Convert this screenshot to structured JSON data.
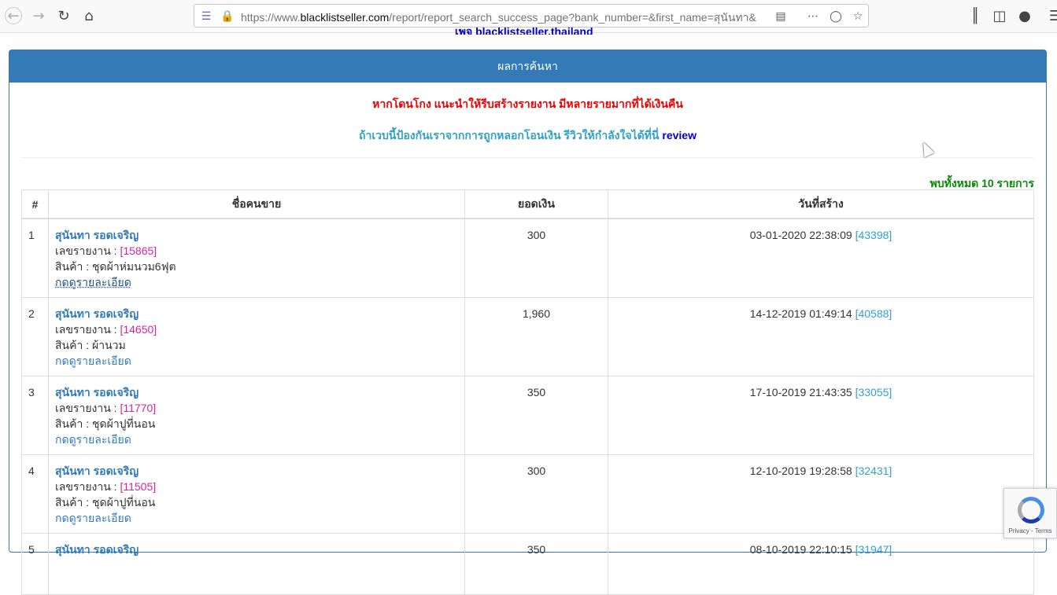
{
  "browser": {
    "url_prefix": "https://www.",
    "url_host": "blacklistseller.com",
    "url_rest": "/report/report_search_success_page?bank_number=&first_name=สุนันทา&"
  },
  "page": {
    "top_link": "เพจ blacklistseller.thailand",
    "panel_title": "ผลการค้นหา",
    "warning": "หากโดนโกง แนะนำให้รีบสร้างรายงาน มีหลายรายมากที่ได้เงินคืน",
    "review_prompt": "ถ้าเวบนี้ป้องกันเราจากการถูกหลอกโอนเงิน รีวิวให้กำลังใจได้ที่นี่",
    "review_link": "review",
    "total": "พบทั้งหมด 10 รายการ"
  },
  "table": {
    "headers": {
      "num": "#",
      "name": "ชื่อคนขาย",
      "amount": "ยอดเงิน",
      "date": "วันที่สร้าง"
    },
    "report_label": "เลขรายงาน :",
    "product_label": "สินค้า :",
    "detail_link": "กดดูรายละเอียด",
    "rows": [
      {
        "num": "1",
        "name": "สุนันทา รอดเจริญ",
        "report_no": "[15865]",
        "product": "ชุดผ้าห่มนวม6ฟุต",
        "amount": "300",
        "date": "03-01-2020 22:38:09",
        "id": "[43398]"
      },
      {
        "num": "2",
        "name": "สุนันทา รอดเจริญ",
        "report_no": "[14650]",
        "product": "ผ้านวม",
        "amount": "1,960",
        "date": "14-12-2019 01:49:14",
        "id": "[40588]"
      },
      {
        "num": "3",
        "name": "สุนันทา รอดเจริญ",
        "report_no": "[11770]",
        "product": "ชุดผ้าปูที่นอน",
        "amount": "350",
        "date": "17-10-2019 21:43:35",
        "id": "[33055]"
      },
      {
        "num": "4",
        "name": "สุนันทา รอดเจริญ",
        "report_no": "[11505]",
        "product": "ชุดผ้าปูที่นอน",
        "amount": "300",
        "date": "12-10-2019 19:28:58",
        "id": "[32431]"
      },
      {
        "num": "5",
        "name": "สุนันทา รอดเจริญ",
        "report_no": "",
        "product": "",
        "amount": "350",
        "date": "08-10-2019 22:10:15",
        "id": "[31947]"
      }
    ]
  },
  "recaptcha": {
    "text": "Privacy - Terms"
  }
}
